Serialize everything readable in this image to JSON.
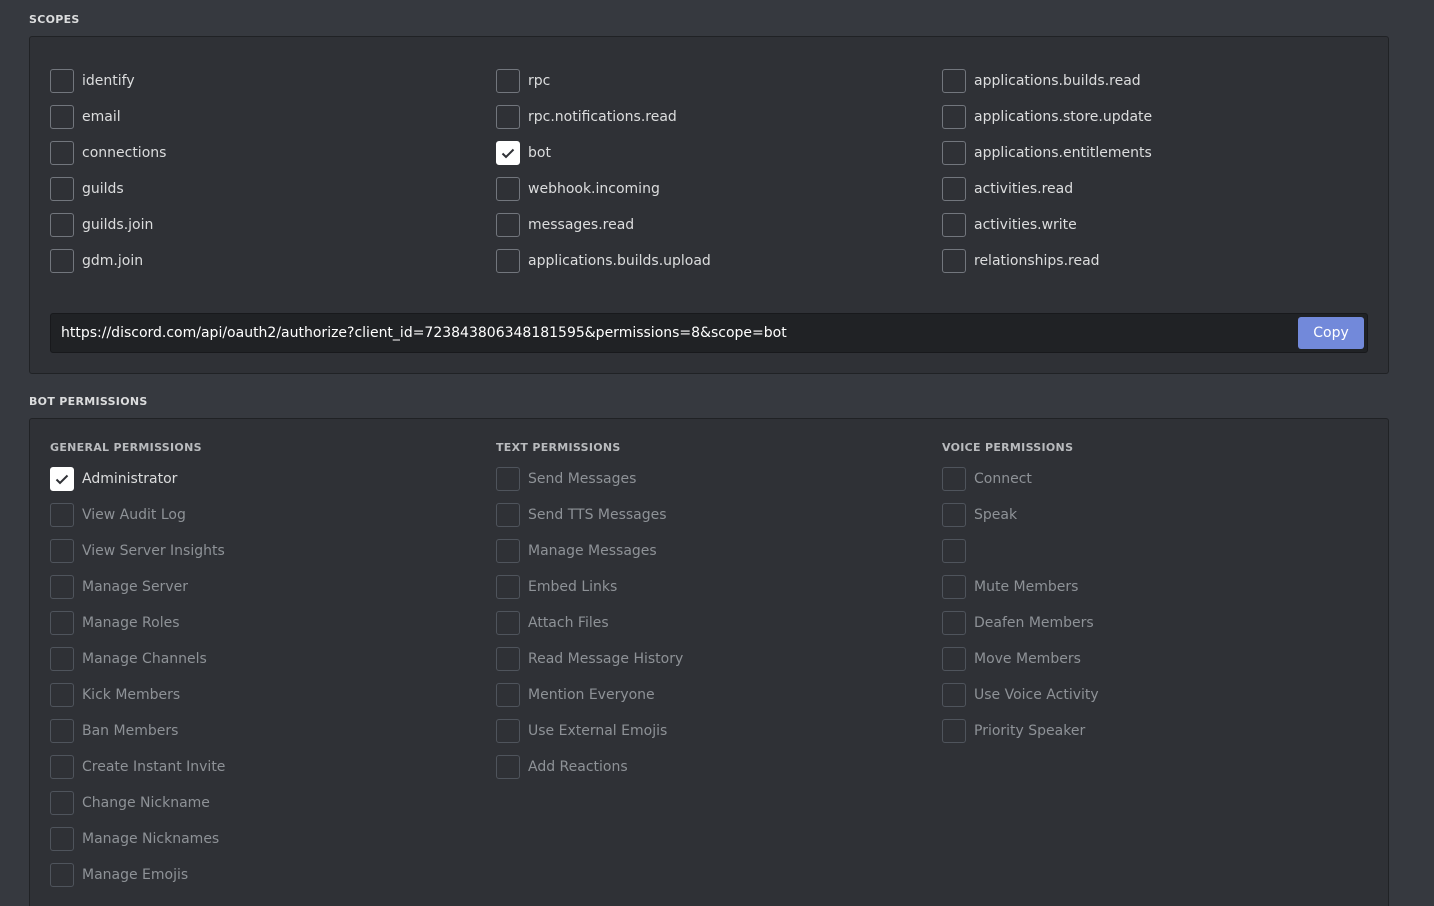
{
  "scopes": {
    "title": "SCOPES",
    "columns": [
      [
        {
          "label": "identify",
          "checked": false
        },
        {
          "label": "email",
          "checked": false
        },
        {
          "label": "connections",
          "checked": false
        },
        {
          "label": "guilds",
          "checked": false
        },
        {
          "label": "guilds.join",
          "checked": false
        },
        {
          "label": "gdm.join",
          "checked": false
        }
      ],
      [
        {
          "label": "rpc",
          "checked": false
        },
        {
          "label": "rpc.notifications.read",
          "checked": false
        },
        {
          "label": "bot",
          "checked": true
        },
        {
          "label": "webhook.incoming",
          "checked": false
        },
        {
          "label": "messages.read",
          "checked": false
        },
        {
          "label": "applications.builds.upload",
          "checked": false
        }
      ],
      [
        {
          "label": "applications.builds.read",
          "checked": false
        },
        {
          "label": "applications.store.update",
          "checked": false
        },
        {
          "label": "applications.entitlements",
          "checked": false
        },
        {
          "label": "activities.read",
          "checked": false
        },
        {
          "label": "activities.write",
          "checked": false
        },
        {
          "label": "relationships.read",
          "checked": false
        }
      ]
    ],
    "url": "https://discord.com/api/oauth2/authorize?client_id=723843806348181595&permissions=8&scope=bot",
    "copy_label": "Copy"
  },
  "bot_permissions": {
    "title": "BOT PERMISSIONS",
    "columns": [
      {
        "heading": "GENERAL PERMISSIONS",
        "items": [
          {
            "label": "Administrator",
            "checked": true,
            "dim": false
          },
          {
            "label": "View Audit Log",
            "checked": false,
            "dim": true
          },
          {
            "label": "View Server Insights",
            "checked": false,
            "dim": true
          },
          {
            "label": "Manage Server",
            "checked": false,
            "dim": true
          },
          {
            "label": "Manage Roles",
            "checked": false,
            "dim": true
          },
          {
            "label": "Manage Channels",
            "checked": false,
            "dim": true
          },
          {
            "label": "Kick Members",
            "checked": false,
            "dim": true
          },
          {
            "label": "Ban Members",
            "checked": false,
            "dim": true
          },
          {
            "label": "Create Instant Invite",
            "checked": false,
            "dim": true
          },
          {
            "label": "Change Nickname",
            "checked": false,
            "dim": true
          },
          {
            "label": "Manage Nicknames",
            "checked": false,
            "dim": true
          },
          {
            "label": "Manage Emojis",
            "checked": false,
            "dim": true
          }
        ]
      },
      {
        "heading": "TEXT PERMISSIONS",
        "items": [
          {
            "label": "Send Messages",
            "checked": false,
            "dim": true
          },
          {
            "label": "Send TTS Messages",
            "checked": false,
            "dim": true
          },
          {
            "label": "Manage Messages",
            "checked": false,
            "dim": true
          },
          {
            "label": "Embed Links",
            "checked": false,
            "dim": true
          },
          {
            "label": "Attach Files",
            "checked": false,
            "dim": true
          },
          {
            "label": "Read Message History",
            "checked": false,
            "dim": true
          },
          {
            "label": "Mention Everyone",
            "checked": false,
            "dim": true
          },
          {
            "label": "Use External Emojis",
            "checked": false,
            "dim": true
          },
          {
            "label": "Add Reactions",
            "checked": false,
            "dim": true
          }
        ]
      },
      {
        "heading": "VOICE PERMISSIONS",
        "items": [
          {
            "label": "Connect",
            "checked": false,
            "dim": true
          },
          {
            "label": "Speak",
            "checked": false,
            "dim": true
          },
          {
            "label": "",
            "checked": false,
            "dim": true
          },
          {
            "label": "Mute Members",
            "checked": false,
            "dim": true
          },
          {
            "label": "Deafen Members",
            "checked": false,
            "dim": true
          },
          {
            "label": "Move Members",
            "checked": false,
            "dim": true
          },
          {
            "label": "Use Voice Activity",
            "checked": false,
            "dim": true
          },
          {
            "label": "Priority Speaker",
            "checked": false,
            "dim": true
          }
        ]
      }
    ]
  },
  "icons": {
    "checked": "check-icon"
  },
  "colors": {
    "accent": "#7289da",
    "background": "#36393f",
    "panel": "#2f3136"
  }
}
